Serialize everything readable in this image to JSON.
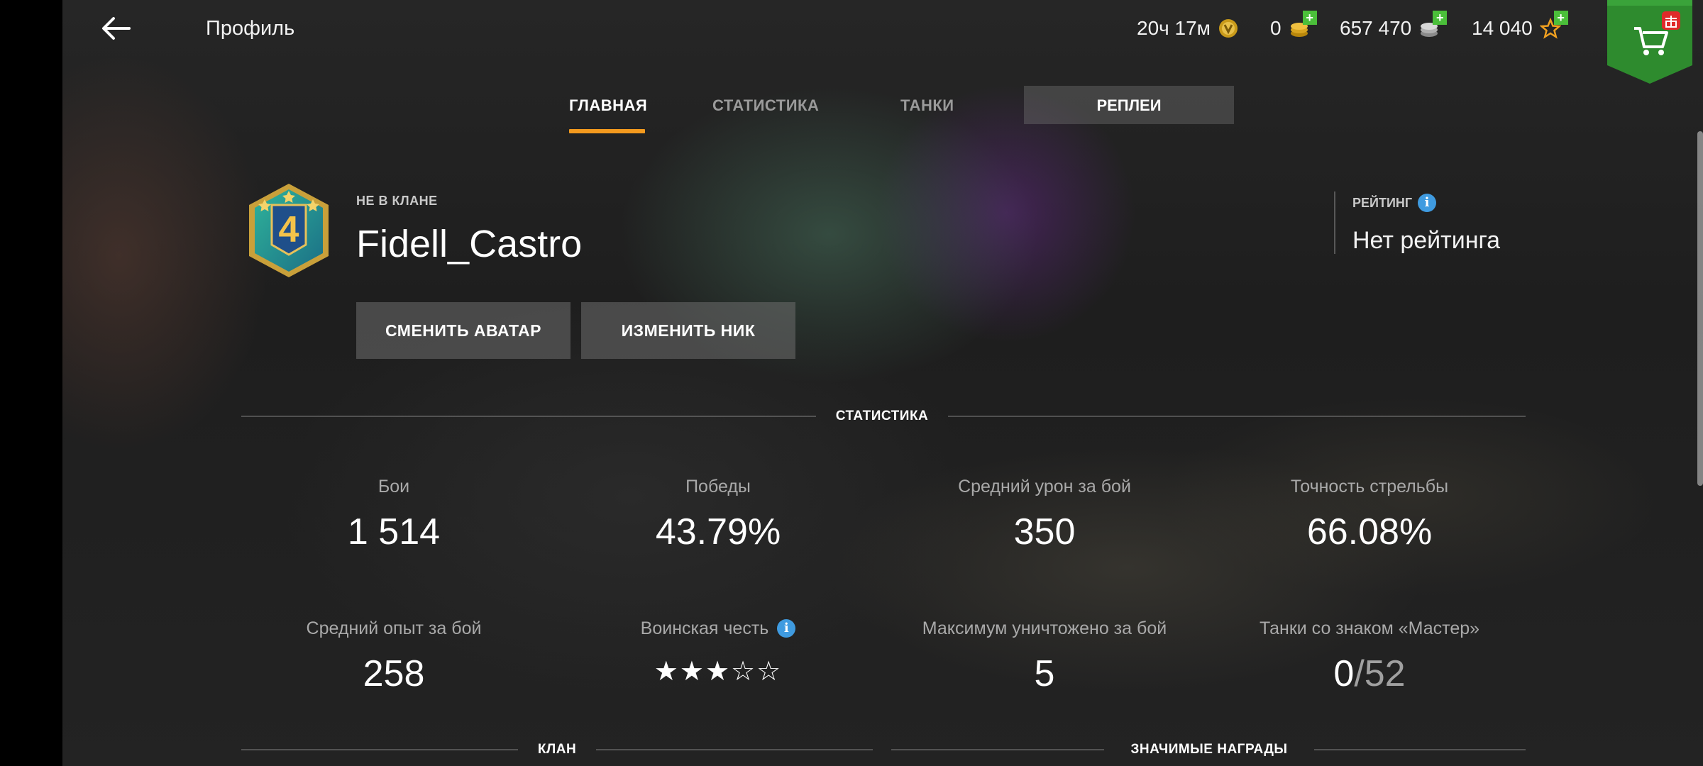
{
  "header": {
    "title": "Профиль",
    "timer": "20ч 17м",
    "gold": "0",
    "credits": "657 470",
    "free_xp": "14 040"
  },
  "tabs": [
    {
      "label": "ГЛАВНАЯ",
      "active": true
    },
    {
      "label": "СТАТИСТИКА",
      "active": false
    },
    {
      "label": "ТАНКИ",
      "active": false
    },
    {
      "label": "РЕПЛЕИ",
      "active": false
    }
  ],
  "profile": {
    "clan_status": "НЕ В КЛАНЕ",
    "nickname": "Fidell_Castro",
    "emblem_level": "4",
    "change_avatar_label": "СМЕНИТЬ АВАТАР",
    "change_nick_label": "ИЗМЕНИТЬ НИК"
  },
  "rating": {
    "label": "РЕЙТИНГ",
    "value": "Нет рейтинга"
  },
  "sections": {
    "stats_title": "СТАТИСТИКА",
    "clan_title": "КЛАН",
    "awards_title": "ЗНАЧИМЫЕ НАГРАДЫ"
  },
  "stats": [
    {
      "label": "Бои",
      "value": "1 514"
    },
    {
      "label": "Победы",
      "value": "43.79%"
    },
    {
      "label": "Средний урон за бой",
      "value": "350"
    },
    {
      "label": "Точность стрельбы",
      "value": "66.08%"
    },
    {
      "label": "Средний опыт за бой",
      "value": "258"
    },
    {
      "label": "Воинская честь",
      "stars_filled": 3,
      "stars_total": 5
    },
    {
      "label": "Максимум уничтожено за бой",
      "value": "5"
    },
    {
      "label": "Танки со знаком «Мастер»",
      "value": "0",
      "value_total": "52"
    }
  ],
  "colors": {
    "accent": "#f39a1e",
    "info": "#3f9be0",
    "shop_green": "#2e8b2e",
    "plus_green": "#4bbf3a"
  }
}
